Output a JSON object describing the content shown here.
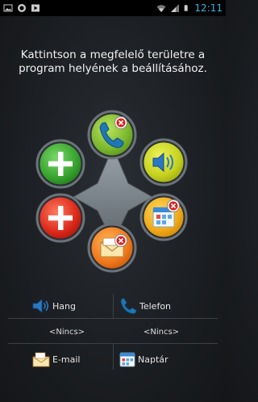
{
  "status_bar": {
    "time": "12:11",
    "icons": [
      "image-icon",
      "sync-icon",
      "play-store-icon",
      "wifi-icon",
      "signal-icon",
      "battery-icon"
    ]
  },
  "instruction": "Kattintson a megfelelő területre a program helyének a beállításához.",
  "dial": {
    "buttons": [
      {
        "name": "phone",
        "icon": "phone-icon",
        "color": "#8dc63f",
        "has_remove_badge": true
      },
      {
        "name": "volume",
        "icon": "speaker-icon",
        "color": "#c8d62a",
        "has_remove_badge": false
      },
      {
        "name": "calendar",
        "icon": "calendar-icon",
        "color": "#f2b515",
        "has_remove_badge": true
      },
      {
        "name": "email",
        "icon": "envelope-icon",
        "color": "#f08020",
        "has_remove_badge": true
      },
      {
        "name": "add-red",
        "icon": "plus-icon",
        "color": "#dd2b1c",
        "has_remove_badge": false
      },
      {
        "name": "add-green",
        "icon": "plus-icon",
        "color": "#3fa535",
        "has_remove_badge": false
      }
    ]
  },
  "assignments": {
    "hang_label": "Hang",
    "telefon_label": "Telefon",
    "left_none": "<Nincs>",
    "right_none": "<Nincs>",
    "email_label": "E-mail",
    "naptar_label": "Naptár"
  },
  "colors": {
    "accent": "#33b5e5",
    "divider": "#3c4146",
    "remove_red": "#d8231e"
  }
}
